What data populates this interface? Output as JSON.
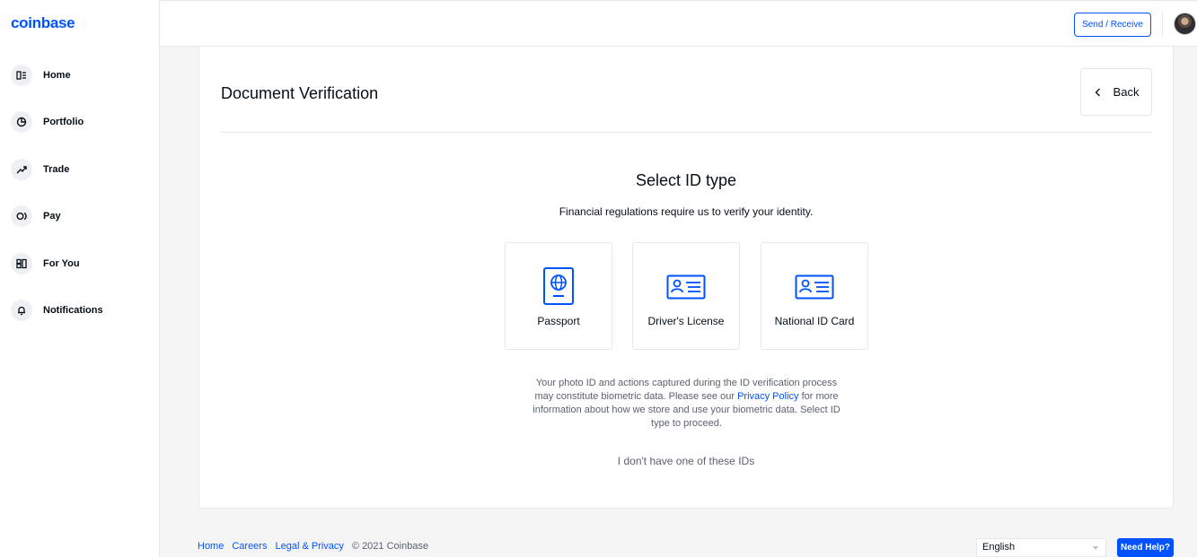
{
  "brand": {
    "logo": "coinbase",
    "accent": "#0052ff"
  },
  "sidebar": {
    "items": [
      {
        "label": "Home",
        "icon": "home-icon"
      },
      {
        "label": "Portfolio",
        "icon": "pie-chart-icon"
      },
      {
        "label": "Trade",
        "icon": "trend-up-icon"
      },
      {
        "label": "Pay",
        "icon": "pay-icon"
      },
      {
        "label": "For You",
        "icon": "for-you-icon"
      },
      {
        "label": "Notifications",
        "icon": "bell-icon"
      }
    ]
  },
  "header": {
    "send_receive_label": "Send / Receive"
  },
  "main": {
    "title": "Document Verification",
    "back_label": "Back",
    "select_title": "Select ID type",
    "select_subtitle": "Financial regulations require us to verify your identity.",
    "id_options": [
      {
        "label": "Passport",
        "icon": "passport-icon"
      },
      {
        "label": "Driver's License",
        "icon": "id-card-icon"
      },
      {
        "label": "National ID Card",
        "icon": "id-card-icon"
      }
    ],
    "disclaimer_before": "Your photo ID and actions captured during the ID verification process may constitute biometric data. Please see our ",
    "disclaimer_link": "Privacy Policy",
    "disclaimer_after": " for more information about how we store and use your biometric data. Select ID type to proceed.",
    "no_id_label": "I don't have one of these IDs"
  },
  "footer": {
    "links": [
      "Home",
      "Careers",
      "Legal & Privacy"
    ],
    "copyright": "© 2021 Coinbase",
    "language": "English",
    "help_label": "Need Help?"
  }
}
